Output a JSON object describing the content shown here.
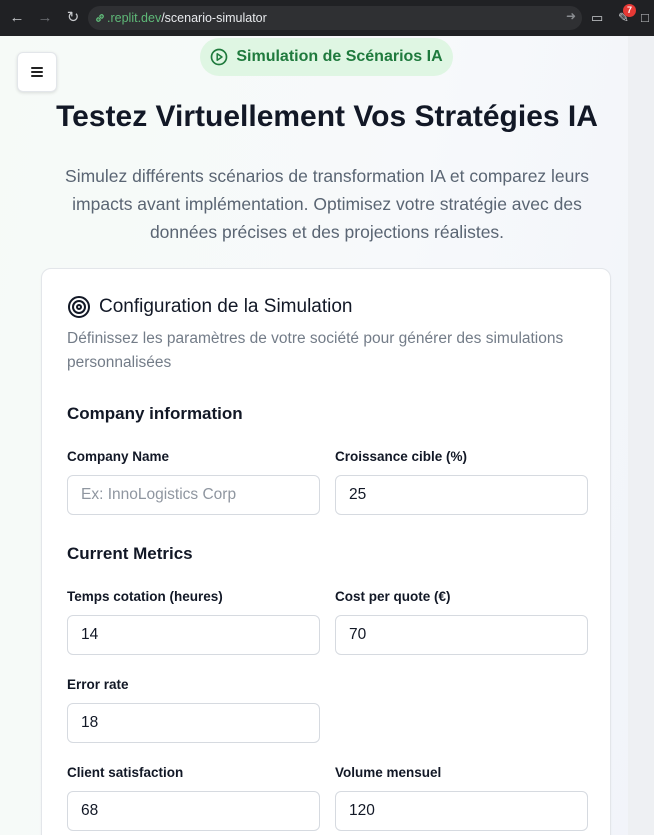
{
  "browser": {
    "url_host": ".replit.dev",
    "url_path": "/scenario-simulator",
    "notification_count": "7"
  },
  "header": {
    "pill_label": "Simulation de Scénarios IA",
    "title": "Testez Virtuellement Vos Stratégies IA",
    "subtitle": "Simulez différents scénarios de transformation IA et comparez leurs impacts avant implémentation. Optimisez votre stratégie avec des données précises et des projections réalistes."
  },
  "config": {
    "title": "Configuration de la Simulation",
    "description": "Définissez les paramètres de votre société pour générer des simulations personnalisées",
    "company_section": "Company information",
    "company_name_label": "Company Name",
    "company_name_placeholder": "Ex: InnoLogistics Corp",
    "company_name_value": "",
    "growth_label": "Croissance cible (%)",
    "growth_value": "25",
    "metrics_section": "Current Metrics",
    "quote_time_label": "Temps cotation (heures)",
    "quote_time_value": "14",
    "cost_label": "Cost per quote (€)",
    "cost_value": "70",
    "error_label": "Error rate",
    "error_value": "18",
    "satisfaction_label": "Client satisfaction",
    "satisfaction_value": "68",
    "volume_label": "Volume mensuel",
    "volume_value": "120"
  },
  "colors": {
    "accent_green": "#1f7a3d",
    "pill_bg": "#dff6e3",
    "title_color": "#121826"
  },
  "icons": {
    "pill": "play-circle-icon",
    "config": "target-icon",
    "menu": "hamburger-menu-icon"
  }
}
